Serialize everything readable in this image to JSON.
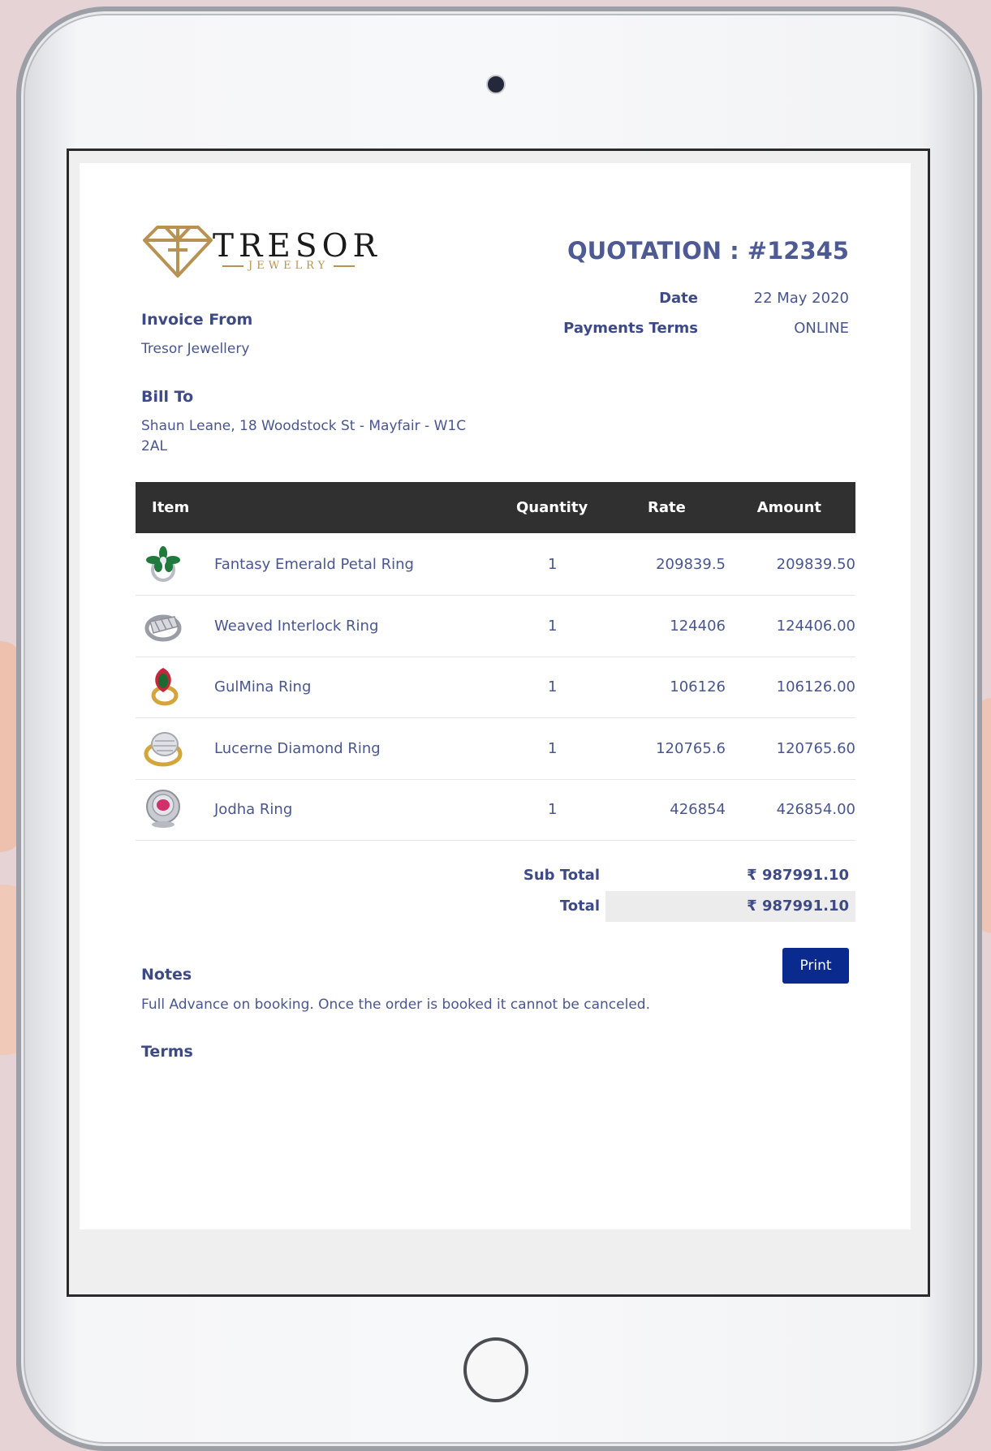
{
  "brand": {
    "name": "TRESOR",
    "tagline": "JEWELRY",
    "gold": "#b79253"
  },
  "header": {
    "quotation_label": "QUOTATION : #12345",
    "date_label": "Date",
    "date_value": "22 May 2020",
    "payment_terms_label": "Payments Terms",
    "payment_terms_value": "ONLINE"
  },
  "invoice_from": {
    "label": "Invoice From",
    "value": "Tresor Jewellery"
  },
  "bill_to": {
    "label": "Bill To",
    "line1": "Shaun Leane, 18 Woodstock St - Mayfair - W1C",
    "line2": "2AL"
  },
  "table": {
    "headers": {
      "item": "Item",
      "quantity": "Quantity",
      "rate": "Rate",
      "amount": "Amount"
    },
    "rows": [
      {
        "name": "Fantasy Emerald Petal Ring",
        "quantity": "1",
        "rate": "209839.5",
        "amount": "209839.50",
        "thumb": "emerald-petal-ring-icon"
      },
      {
        "name": "Weaved Interlock Ring",
        "quantity": "1",
        "rate": "124406",
        "amount": "124406.00",
        "thumb": "interlock-ring-icon"
      },
      {
        "name": "GulMina Ring",
        "quantity": "1",
        "rate": "106126",
        "amount": "106126.00",
        "thumb": "gulmina-ring-icon"
      },
      {
        "name": "Lucerne Diamond Ring",
        "quantity": "1",
        "rate": "120765.6",
        "amount": "120765.60",
        "thumb": "diamond-ring-icon"
      },
      {
        "name": "Jodha Ring",
        "quantity": "1",
        "rate": "426854",
        "amount": "426854.00",
        "thumb": "ruby-ring-icon"
      }
    ]
  },
  "totals": {
    "subtotal_label": "Sub Total",
    "subtotal_value": "₹ 987991.10",
    "total_label": "Total",
    "total_value": "₹ 987991.10"
  },
  "notes": {
    "label": "Notes",
    "text": "Full Advance on booking. Once the order is booked it cannot be canceled."
  },
  "terms": {
    "label": "Terms"
  },
  "actions": {
    "print_label": "Print"
  },
  "colors": {
    "text": "#4a5690",
    "table_header_bg": "#303030",
    "button_bg": "#0b2a8e",
    "background": "#e6d3d5"
  }
}
